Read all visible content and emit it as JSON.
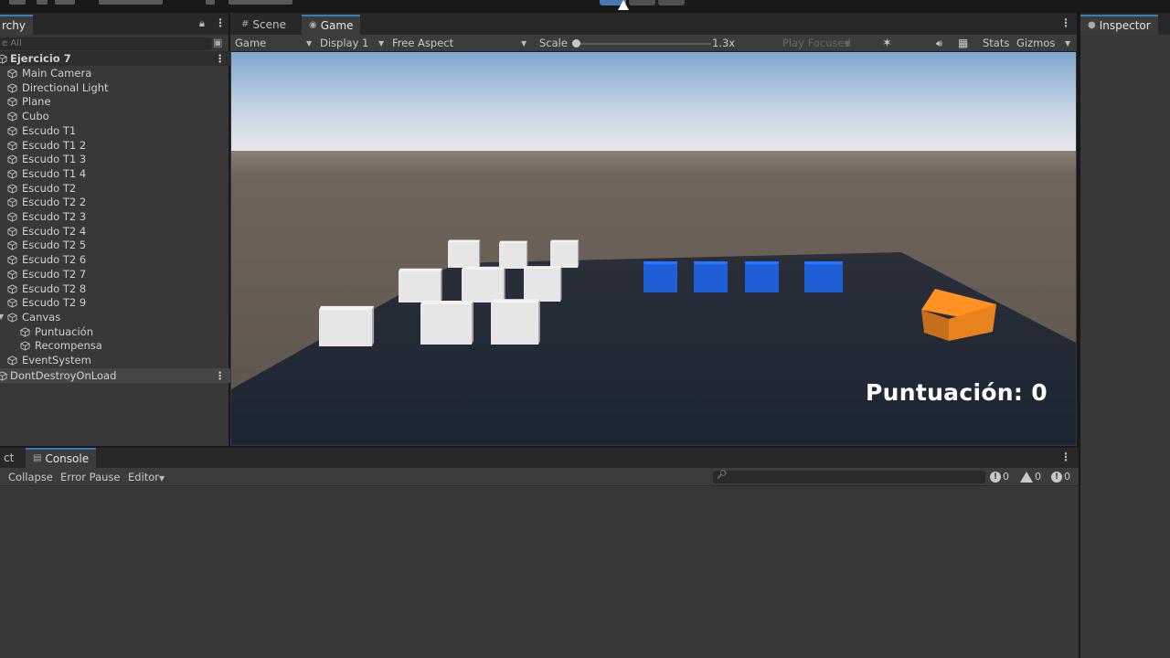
{
  "hierarchy": {
    "tab_label": "rchy",
    "search_placeholder": "e All",
    "scene_name": "Ejercicio 7",
    "items": [
      {
        "label": "Main Camera",
        "indent": 1
      },
      {
        "label": "Directional Light",
        "indent": 1
      },
      {
        "label": "Plane",
        "indent": 1
      },
      {
        "label": "Cubo",
        "indent": 1
      },
      {
        "label": "Escudo T1",
        "indent": 1
      },
      {
        "label": "Escudo T1 2",
        "indent": 1
      },
      {
        "label": "Escudo T1 3",
        "indent": 1
      },
      {
        "label": "Escudo T1 4",
        "indent": 1
      },
      {
        "label": "Escudo T2",
        "indent": 1
      },
      {
        "label": "Escudo T2 2",
        "indent": 1
      },
      {
        "label": "Escudo T2 3",
        "indent": 1
      },
      {
        "label": "Escudo T2 4",
        "indent": 1
      },
      {
        "label": "Escudo T2 5",
        "indent": 1
      },
      {
        "label": "Escudo T2 6",
        "indent": 1
      },
      {
        "label": "Escudo T2 7",
        "indent": 1
      },
      {
        "label": "Escudo T2 8",
        "indent": 1
      },
      {
        "label": "Escudo T2 9",
        "indent": 1
      },
      {
        "label": "Canvas",
        "indent": 1
      },
      {
        "label": "Puntuación",
        "indent": 2
      },
      {
        "label": "Recompensa",
        "indent": 2
      },
      {
        "label": "EventSystem",
        "indent": 1
      }
    ],
    "ddol_label": "DontDestroyOnLoad"
  },
  "game_view": {
    "tabs": [
      {
        "label": "Scene",
        "icon": "grid-icon"
      },
      {
        "label": "Game",
        "icon": "gamepad-icon"
      }
    ],
    "toolbar": {
      "mode": "Game",
      "display": "Display 1",
      "aspect": "Free Aspect",
      "scale_label": "Scale",
      "scale_value": "1.3x",
      "play_focused": "Play Focused",
      "stats": "Stats",
      "gizmos": "Gizmos"
    },
    "score_text": "Puntuación: 0",
    "colors": {
      "white_cube": "#e6e6e6",
      "blue_cube": "#1e5fd8",
      "orange_cube": "#e8821e",
      "plane": "#1e2633",
      "sky_top": "#7fa6d1",
      "ground": "#6a6159"
    }
  },
  "inspector": {
    "tab_label": "Inspector"
  },
  "console": {
    "tabs": [
      "ct",
      "Console"
    ],
    "collapse": "Collapse",
    "error_pause": "Error Pause",
    "editor": "Editor",
    "counts": {
      "info": "0",
      "warning": "0",
      "error": "0"
    }
  }
}
